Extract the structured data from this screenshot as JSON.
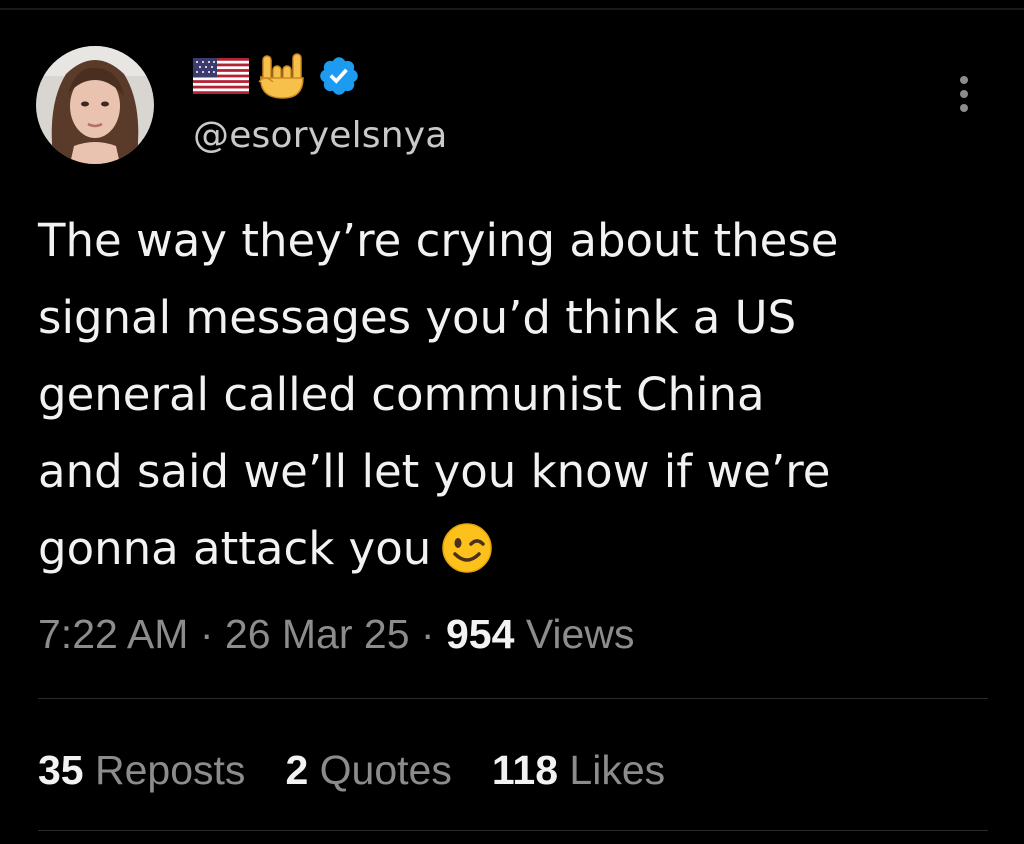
{
  "tweet": {
    "author": {
      "display_name_icons": [
        "us-flag-icon",
        "love-you-gesture-icon",
        "verified-badge-icon"
      ],
      "handle": "@esoryelsnya"
    },
    "text": "The way they’re crying about these\nsignal messages you’d think a US\ngeneral called communist China\nand said we’ll let you know if we’re\ngonna attack you",
    "text_trailing_emoji": "winking-face-icon",
    "time": "7:22 AM",
    "separator": "·",
    "date": "26 Mar 25",
    "views_count": "954",
    "views_label": "Views",
    "stats": [
      {
        "count": "35",
        "label": "Reposts"
      },
      {
        "count": "2",
        "label": "Quotes"
      },
      {
        "count": "118",
        "label": "Likes"
      }
    ]
  },
  "colors": {
    "background": "#000000",
    "text": "#f2f2f2",
    "muted": "#8c8c8c",
    "verified": "#1d9bf0"
  }
}
